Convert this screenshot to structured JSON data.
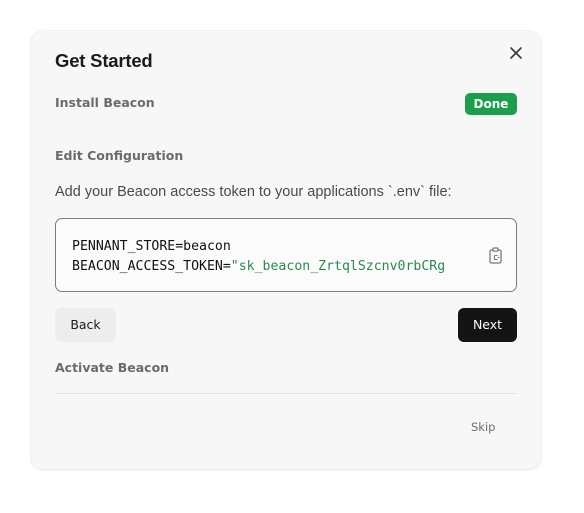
{
  "dialog": {
    "title": "Get Started",
    "close_icon": "close-icon"
  },
  "steps": [
    {
      "label": "Install Beacon",
      "status": "Done"
    },
    {
      "label": "Edit Configuration"
    },
    {
      "label": "Activate Beacon"
    }
  ],
  "config": {
    "description": "Add your Beacon access token to your applications `.env` file:",
    "code_line1": "PENNANT_STORE=beacon",
    "code_line2_key": "BEACON_ACCESS_TOKEN=",
    "code_line2_value": "\"sk_beacon_ZrtqlSzcnv0rbCRg",
    "copy_icon": "clipboard-copy-icon"
  },
  "buttons": {
    "back": "Back",
    "next": "Next",
    "skip": "Skip"
  },
  "colors": {
    "done_badge": "#1aa04a",
    "code_string": "#2a8a4c",
    "primary_button": "#141414"
  }
}
